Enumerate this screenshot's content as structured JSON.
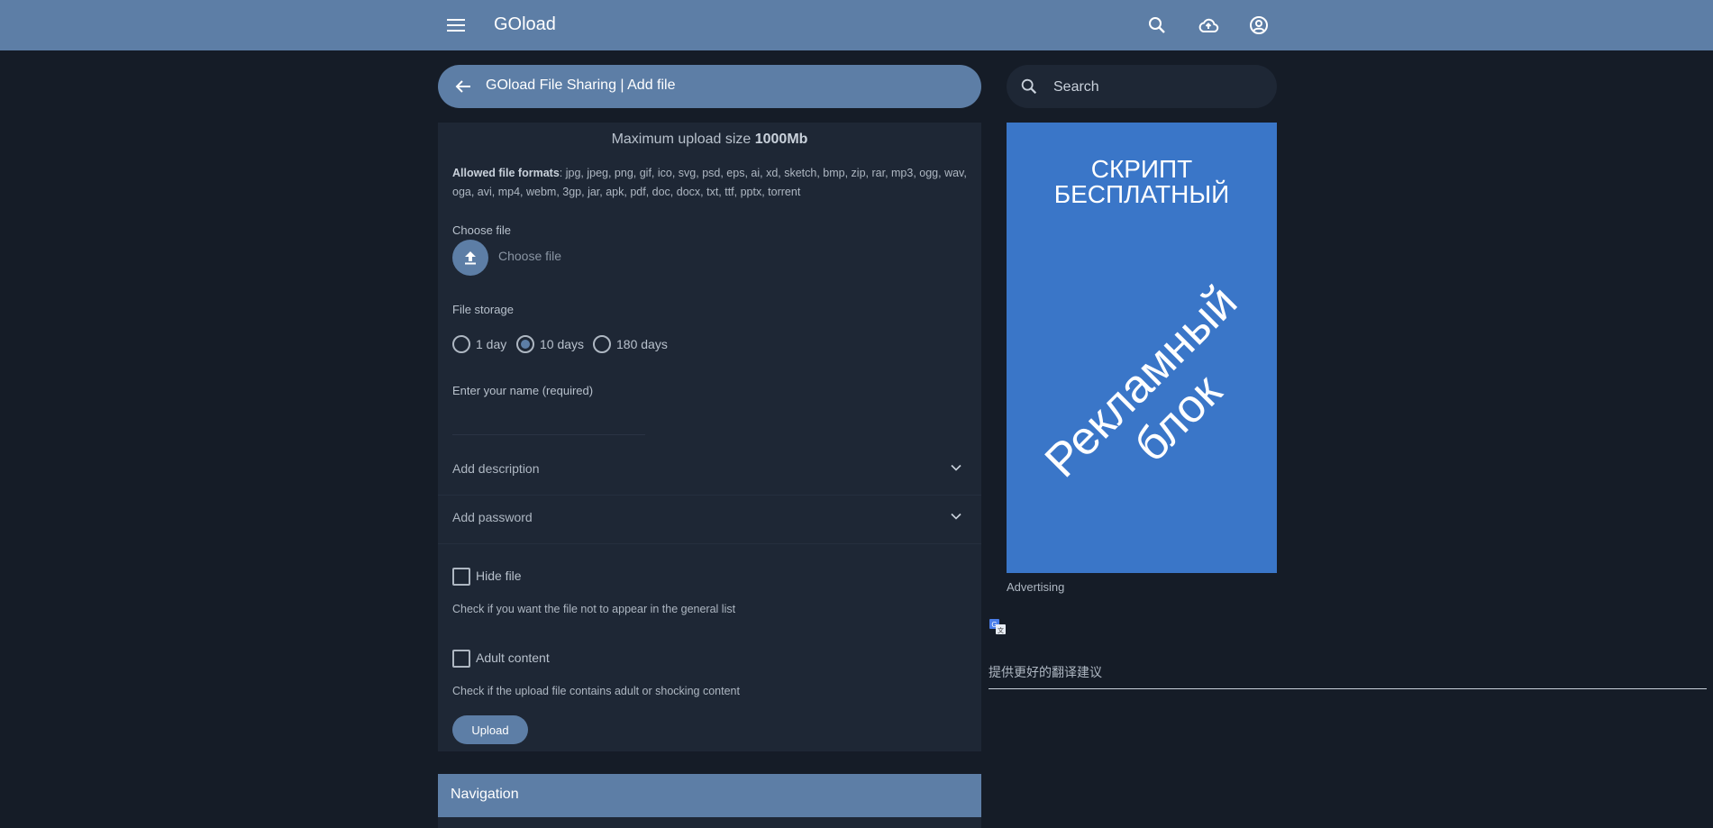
{
  "topbar": {
    "brand": "GOload",
    "icons": [
      "menu-icon",
      "search-icon",
      "cloud-upload-icon",
      "account-circle-icon"
    ]
  },
  "titlebar": {
    "title": "GOload File Sharing | Add file"
  },
  "search": {
    "placeholder": "Search"
  },
  "form": {
    "max_label": "Maximum upload size ",
    "max_value": "1000Mb",
    "formats_label": "Allowed file formats",
    "formats_list": ": jpg, jpeg, png, gif, ico, svg, psd, eps, ai, xd, sketch, bmp, zip, rar, mp3, ogg, wav, oga, avi, mp4, webm, 3gp, jar, apk, pdf, doc, docx, txt, ttf, pptx, torrent",
    "choose_label": "Choose file",
    "choose_placeholder": "Choose file",
    "storage_label": "File storage",
    "storage_options": [
      {
        "label": "1 day",
        "selected": false
      },
      {
        "label": "10 days",
        "selected": true
      },
      {
        "label": "180 days",
        "selected": false
      }
    ],
    "name_label": "Enter your name (required)",
    "name_value": "",
    "add_description": "Add description",
    "add_password": "Add password",
    "hide_label": "Hide file",
    "hide_hint": "Check if you want the file not to appear in the general list",
    "adult_label": "Adult content",
    "adult_hint": "Check if the upload file contains adult or shocking content",
    "upload_button": "Upload"
  },
  "navigation": {
    "title": "Navigation"
  },
  "sidebar": {
    "ad_line1": "СКРИПТ",
    "ad_line2": "БЕСПЛАТНЫЙ",
    "ad_diag1": "Рекламный",
    "ad_diag2": "блок",
    "ad_label": "Advertising",
    "translate_suggest": "提供更好的翻译建议"
  },
  "colors": {
    "background": "#151c27",
    "panel": "#1e2735",
    "accent": "#5d7ea6",
    "ad": "#3a76c8"
  }
}
